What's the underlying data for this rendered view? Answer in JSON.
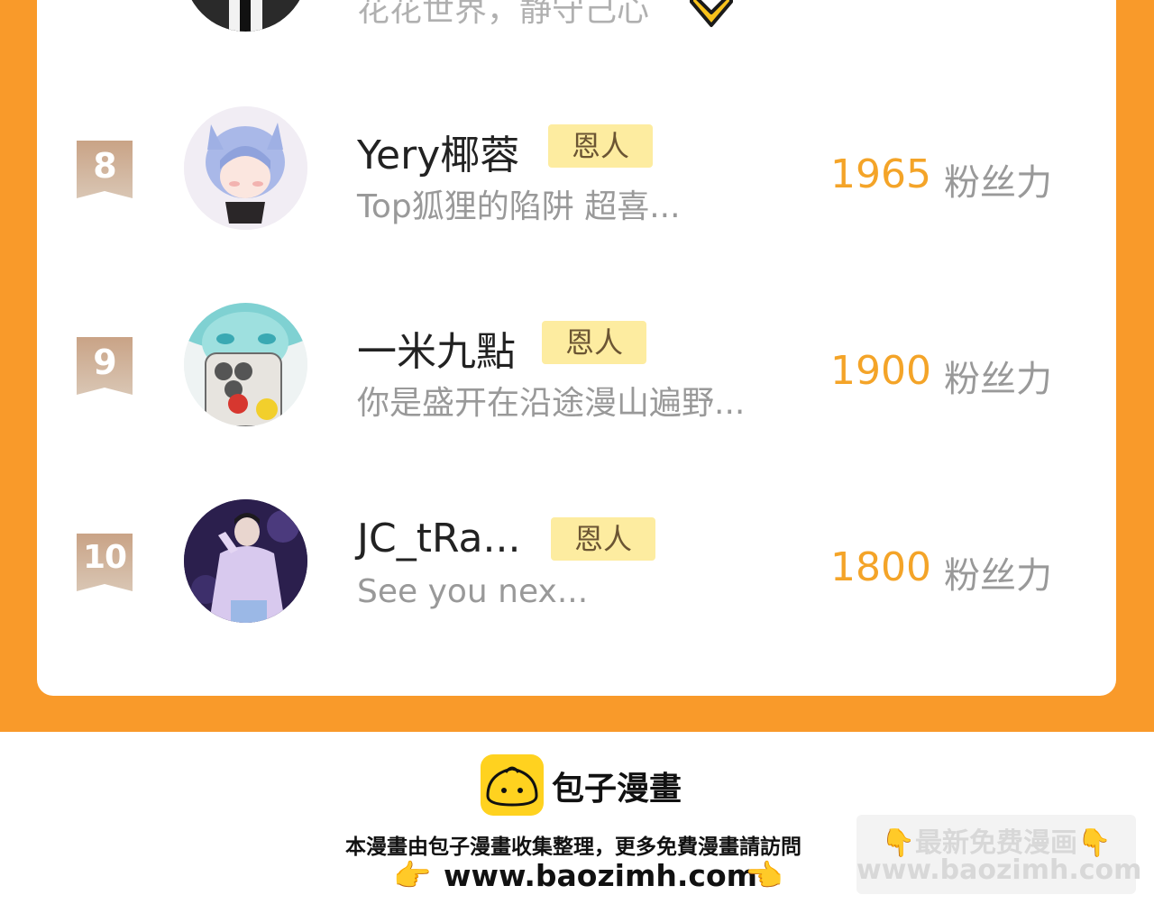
{
  "partial_row": {
    "sub": "花花世界，静守己心",
    "emoji_icon": "yellow-heart-emoji-icon"
  },
  "rows": [
    {
      "rank": "8",
      "name": "Yery椰蓉",
      "badge": "恩人",
      "sub": "Top狐狸的陷阱 超喜...",
      "score": "1965",
      "unit": "粉丝力",
      "avatar": "blue-hair-anime-avatar"
    },
    {
      "rank": "9",
      "name": "一米九點",
      "badge": "恩人",
      "sub": "你是盛开在沿途漫山遍野...",
      "score": "1900",
      "unit": "粉丝力",
      "avatar": "teal-hair-phone-avatar"
    },
    {
      "rank": "10",
      "name": "JC_tRa...",
      "badge": "恩人",
      "sub": "See you nex...",
      "score": "1800",
      "unit": "粉丝力",
      "avatar": "stage-singer-avatar"
    }
  ],
  "footer": {
    "logo_text": "包子漫畫",
    "note": "本漫畫由包子漫畫收集整理，更多免費漫畫請訪問",
    "url": "www.baozimh.com",
    "hand_left": "👉",
    "hand_right": "👈"
  },
  "watermark": {
    "line1": "👇最新免费漫画👇",
    "line2": "www.baozimh.com"
  },
  "colors": {
    "orange_bg": "#f99a2a",
    "score": "#f4a428",
    "badge_bg": "#fdeca0",
    "rank_tag": "#c7a88a"
  }
}
